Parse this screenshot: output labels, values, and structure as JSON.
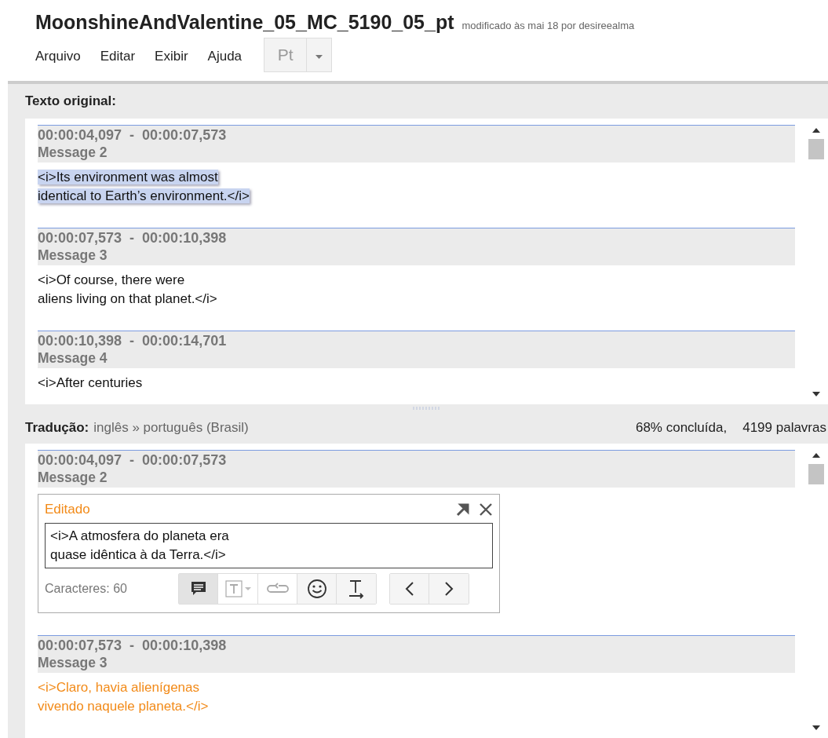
{
  "document": {
    "title": "MoonshineAndValentine_05_MC_5190_05_pt",
    "modified": "modificado às mai 18 por desireealma"
  },
  "menu": [
    {
      "label": "Arquivo"
    },
    {
      "label": "Editar"
    },
    {
      "label": "Exibir"
    },
    {
      "label": "Ajuda"
    }
  ],
  "language_button": {
    "label": "Pt"
  },
  "original": {
    "heading": "Texto original:",
    "segments": [
      {
        "start": "00:00:04,097",
        "separator": "-",
        "end": "00:00:07,573",
        "name": "Message 2",
        "lines": [
          "<i>Its environment was almost",
          "identical to Earth’s environment.</i>"
        ],
        "selected": true
      },
      {
        "start": "00:00:07,573",
        "separator": "-",
        "end": "00:00:10,398",
        "name": "Message 3",
        "lines": [
          "<i>Of course, there were",
          "aliens living on that planet.</i>"
        ],
        "selected": false
      },
      {
        "start": "00:00:10,398",
        "separator": "-",
        "end": "00:00:14,701",
        "name": "Message 4",
        "lines": [
          "<i>After centuries"
        ],
        "selected": false
      }
    ]
  },
  "translation": {
    "heading": "Tradução:",
    "languages": "inglês » português (Brasil)",
    "progress": "68% concluída,",
    "words": "4199 palavras",
    "segments": [
      {
        "kind": "editor",
        "start": "00:00:04,097",
        "separator": "-",
        "end": "00:00:07,573",
        "name": "Message 2",
        "editor": {
          "status": "Editado",
          "lines": [
            "<i>A atmosfera do planeta era",
            "quase idêntica à da Terra.</i>"
          ],
          "count": "Caracteres: 60",
          "tools": [
            {
              "kind": "comment",
              "pressed": true,
              "disabled": false
            },
            {
              "kind": "textbox",
              "pressed": false,
              "disabled": true
            },
            {
              "kind": "link",
              "pressed": false,
              "disabled": true
            },
            {
              "kind": "smiley",
              "pressed": false,
              "disabled": false
            },
            {
              "kind": "format",
              "pressed": false,
              "disabled": false
            }
          ]
        }
      },
      {
        "kind": "text",
        "start": "00:00:07,573",
        "separator": "-",
        "end": "00:00:10,398",
        "name": "Message 3",
        "lines": [
          "<i>Claro, havia alienígenas",
          "vivendo naquele planeta.</i>"
        ],
        "edited": true
      }
    ]
  }
}
